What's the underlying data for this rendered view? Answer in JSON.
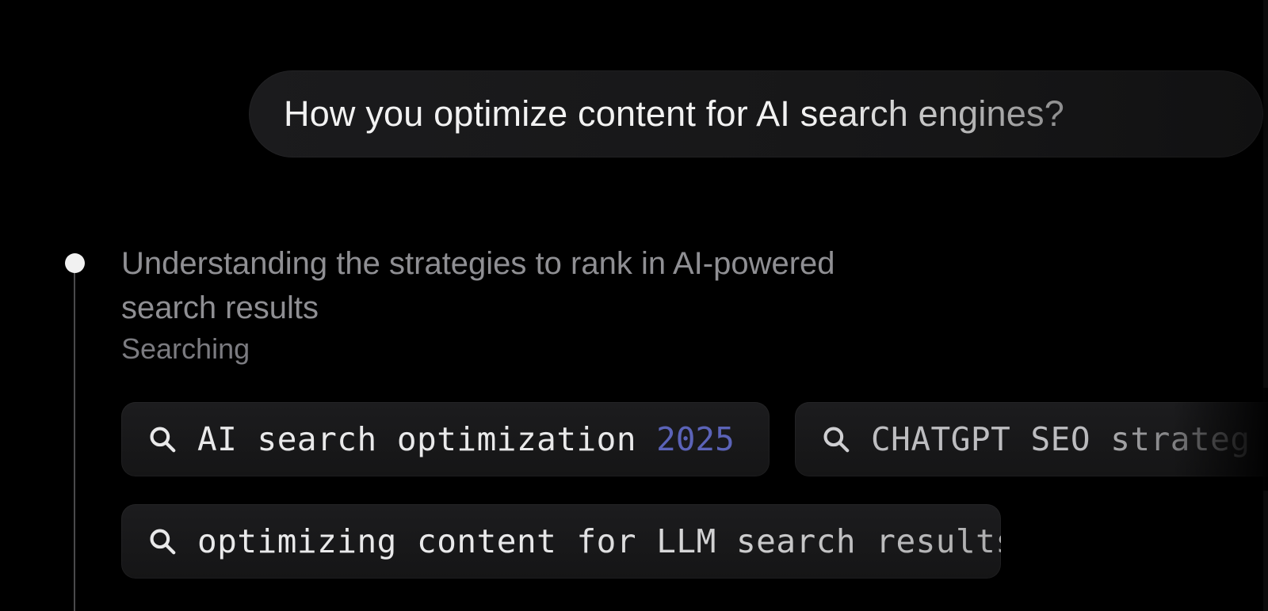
{
  "conversation": {
    "user_message": "How you optimize content for AI search engines?"
  },
  "step": {
    "title": "Understanding the strategies to rank in AI-powered search results",
    "status": "Searching"
  },
  "queries": [
    {
      "text": "AI search optimization",
      "highlight": "2025",
      "icon": "search-icon"
    },
    {
      "text": "CHATGPT SEO strateg",
      "icon": "search-icon"
    },
    {
      "text": "optimizing content for LLM search results",
      "icon": "search-icon"
    }
  ],
  "colors": {
    "background": "#000000",
    "highlight_year": "#5b63b8",
    "timeline_dot": "#f1f1f1"
  }
}
